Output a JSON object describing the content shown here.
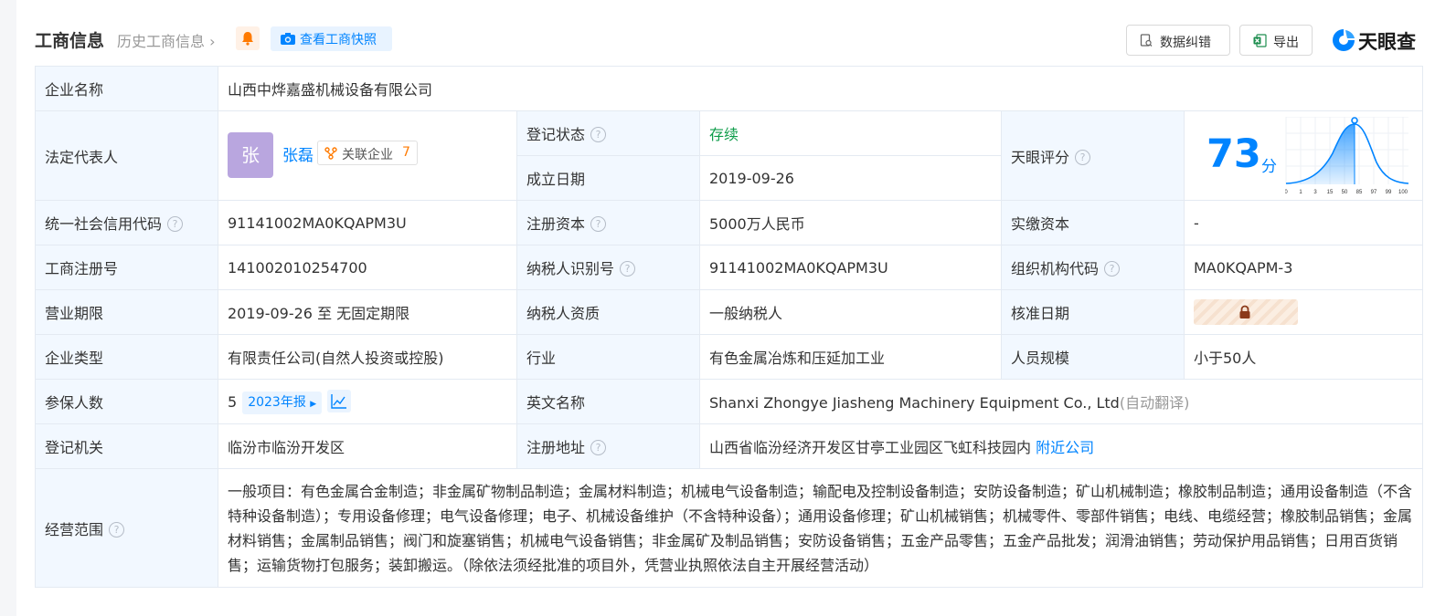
{
  "header": {
    "title": "工商信息",
    "history": "历史工商信息",
    "snapshot_label": "查看工商快照",
    "correct_label": "数据纠错",
    "export_label": "导出",
    "brand": "天眼查"
  },
  "colors": {
    "accent": "#0084ff",
    "status_green": "#0e9c4a",
    "label_bg": "#f2f8ff",
    "warning_orange": "#ff7a00"
  },
  "company": {
    "name_label": "企业名称",
    "name": "山西中烨嘉盛机械设备有限公司",
    "legal_rep_label": "法定代表人",
    "legal_rep_avatar": "张",
    "legal_rep": "张磊",
    "related_label": "关联企业",
    "related_count": "7",
    "status_label": "登记状态",
    "status": "存续",
    "founded_label": "成立日期",
    "founded": "2019-09-26",
    "score_label": "天眼评分",
    "score": "73",
    "score_unit": "分",
    "score_axis": [
      "0",
      "1",
      "3",
      "15",
      "50",
      "85",
      "97",
      "99",
      "100"
    ],
    "credit_code_label": "统一社会信用代码",
    "credit_code": "91141002MA0KQAPM3U",
    "reg_capital_label": "注册资本",
    "reg_capital": "5000万人民币",
    "paid_capital_label": "实缴资本",
    "paid_capital": "-",
    "reg_no_label": "工商注册号",
    "reg_no": "141002010254700",
    "taxpayer_id_label": "纳税人识别号",
    "taxpayer_id": "91141002MA0KQAPM3U",
    "org_code_label": "组织机构代码",
    "org_code": "MA0KQAPM-3",
    "term_label": "营业期限",
    "term": "2019-09-26 至 无固定期限",
    "tax_quality_label": "纳税人资质",
    "tax_quality": "一般纳税人",
    "approve_label": "核准日期",
    "type_label": "企业类型",
    "type": "有限责任公司(自然人投资或控股)",
    "industry_label": "行业",
    "industry": "有色金属冶炼和压延加工业",
    "staff_label": "人员规模",
    "staff": "小于50人",
    "insured_label": "参保人数",
    "insured": "5",
    "insured_year": "2023年报",
    "en_name_label": "英文名称",
    "en_name": "Shanxi Zhongye Jiasheng Machinery Equipment Co., Ltd",
    "en_name_note": "(自动翻译)",
    "authority_label": "登记机关",
    "authority": "临汾市临汾开发区",
    "address_label": "注册地址",
    "address": "山西省临汾经济开发区甘亭工业园区飞虹科技园内",
    "nearby_label": "附近公司",
    "scope_label": "经营范围",
    "scope": "一般项目：有色金属合金制造；非金属矿物制品制造；金属材料制造；机械电气设备制造；输配电及控制设备制造；安防设备制造；矿山机械制造；橡胶制品制造；通用设备制造（不含特种设备制造）；专用设备修理；电气设备修理；电子、机械设备维护（不含特种设备）；通用设备修理；矿山机械销售；机械零件、零部件销售；电线、电缆经营；橡胶制品销售；金属材料销售；金属制品销售；阀门和旋塞销售；机械电气设备销售；非金属矿及制品销售；安防设备销售；五金产品零售；五金产品批发；润滑油销售；劳动保护用品销售；日用百货销售；运输货物打包服务；装卸搬运。（除依法须经批准的项目外，凭营业执照依法自主开展经营活动）"
  },
  "icons": [
    "bell-icon",
    "camera-icon",
    "correction-icon",
    "excel-icon",
    "brand-logo-icon",
    "question-icon",
    "relation-icon",
    "lock-icon",
    "trend-icon",
    "arrow-right-icon"
  ]
}
